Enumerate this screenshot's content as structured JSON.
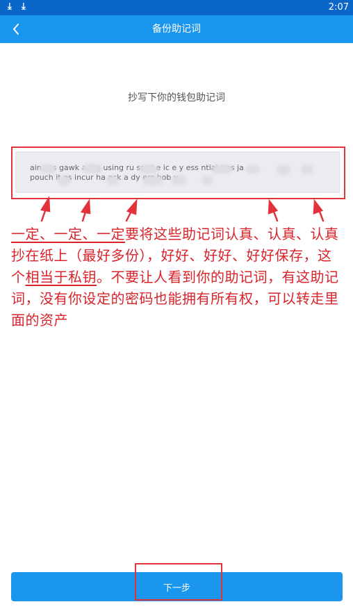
{
  "status_bar": {
    "time": "2:07",
    "icons": [
      "download-icon",
      "download-icon"
    ]
  },
  "header": {
    "title": "备份助记词",
    "back_icon": "chevron-left-icon"
  },
  "instruction": "抄写下你的钱包助记词",
  "mnemonic": {
    "line1": "ain ses gawk a ing using ru ss vi e ic e y ess ntial r es ja",
    "line2": "pouch it es incur ha ack a dy ers hob y"
  },
  "annotation": {
    "part1": "一定、一定、一定",
    "part2": "要将这些助记词认真、认真、认真抄在纸上（最好多份），好好、好好、好好保存，这个",
    "part3": "相当于私钥",
    "part4": "。不要让人看到你的助记词，有这助记词，没有你设定的密码也能拥有所有权，可以转走里面的资产"
  },
  "footer": {
    "next_label": "下一步"
  },
  "colors": {
    "primary": "#1a96ee",
    "status_bar": "#0a66c8",
    "annotation_red": "#d8232a"
  }
}
